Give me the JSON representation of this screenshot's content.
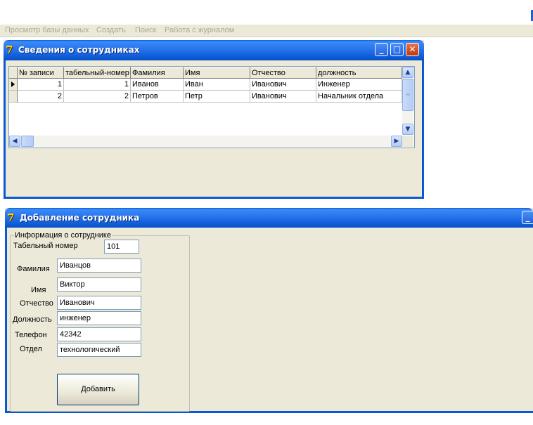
{
  "menu": [
    "Просмотр базы данных",
    "Создать",
    "Поиск",
    "Работа с журналом"
  ],
  "employees_window": {
    "title": "Сведения о сотрудниках",
    "columns": [
      "№ записи",
      "табельный-номер",
      "Фамилия",
      "Имя",
      "Отчество",
      "должность"
    ],
    "rows": [
      [
        "1",
        "1",
        "Иванов",
        "Иван",
        "Иванович",
        "Инженер"
      ],
      [
        "2",
        "2",
        "Петров",
        "Петр",
        "Иванович",
        "Начальник отдела"
      ]
    ],
    "current_row": 1
  },
  "add_window": {
    "title": "Добавление сотрудника",
    "group_title": "Информация о сотруднике",
    "fields": {
      "tab_number": {
        "label": "Табельный номер",
        "value": "101"
      },
      "surname": {
        "label": "Фамилия",
        "value": "Иванцов"
      },
      "name": {
        "label": "Имя",
        "value": "Виктор"
      },
      "patronymic": {
        "label": "Отчество",
        "value": "Иванович"
      },
      "position": {
        "label": "Должность",
        "value": "инженер"
      },
      "phone": {
        "label": "Телефон",
        "value": "42342"
      },
      "department": {
        "label": "Отдел",
        "value": "технологический"
      }
    },
    "add_button": "Добавить"
  },
  "icons": {
    "app_icon": "delphi-app-icon",
    "minimize": "minimize-icon",
    "maximize": "maximize-icon",
    "close": "close-icon"
  }
}
